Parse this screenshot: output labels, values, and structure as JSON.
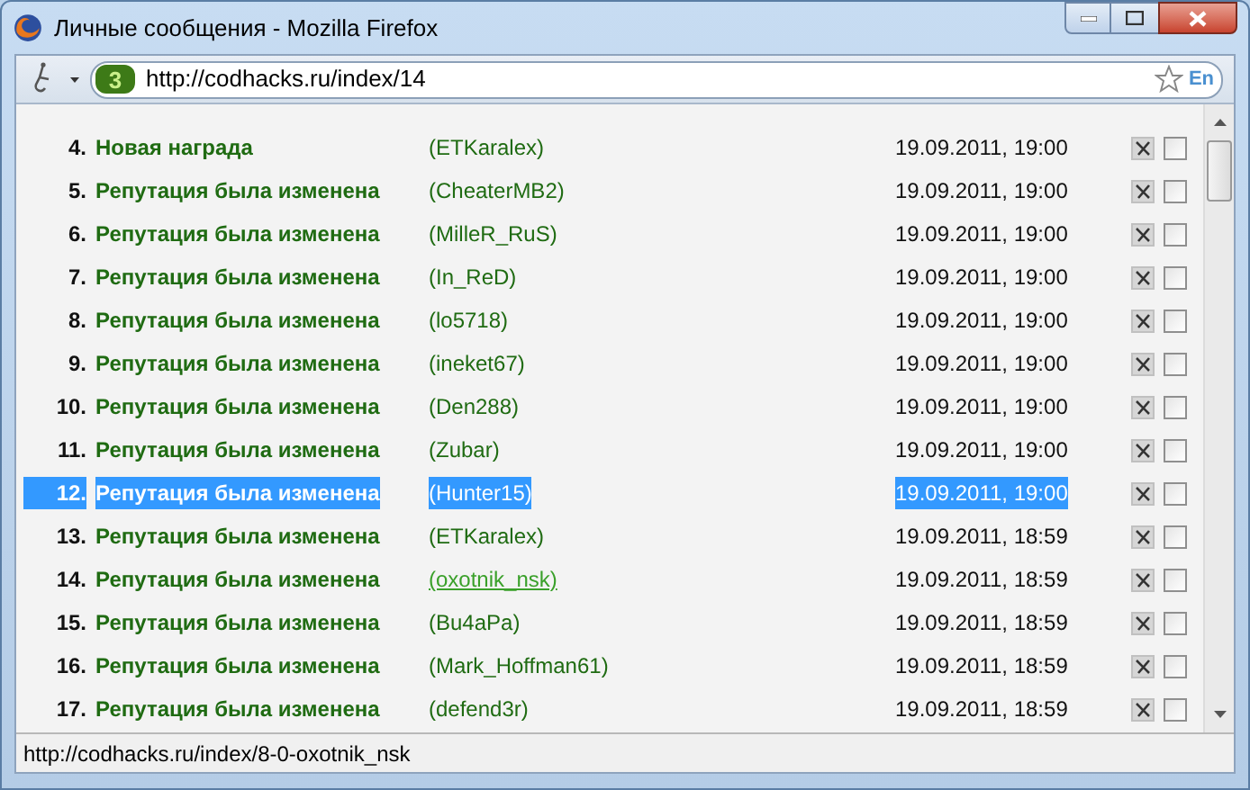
{
  "window": {
    "title": "Личные сообщения - Mozilla Firefox"
  },
  "address_bar": {
    "site_badge": "3",
    "url": "http://codhacks.ru/index/14",
    "lang": "En"
  },
  "messages": [
    {
      "number": "4.",
      "title": "Новая награда",
      "user": "(ETKaralex)",
      "date": "19.09.2011, 19:00",
      "selected": false,
      "hovered": false,
      "checked": false
    },
    {
      "number": "5.",
      "title": "Репутация была изменена",
      "user": "(CheaterMB2)",
      "date": "19.09.2011, 19:00",
      "selected": false,
      "hovered": false,
      "checked": false
    },
    {
      "number": "6.",
      "title": "Репутация была изменена",
      "user": "(MilleR_RuS)",
      "date": "19.09.2011, 19:00",
      "selected": false,
      "hovered": false,
      "checked": false
    },
    {
      "number": "7.",
      "title": "Репутация была изменена",
      "user": "(In_ReD)",
      "date": "19.09.2011, 19:00",
      "selected": false,
      "hovered": false,
      "checked": false
    },
    {
      "number": "8.",
      "title": "Репутация была изменена",
      "user": "(lo5718)",
      "date": "19.09.2011, 19:00",
      "selected": false,
      "hovered": false,
      "checked": false
    },
    {
      "number": "9.",
      "title": "Репутация была изменена",
      "user": "(ineket67)",
      "date": "19.09.2011, 19:00",
      "selected": false,
      "hovered": false,
      "checked": false
    },
    {
      "number": "10.",
      "title": "Репутация была изменена",
      "user": "(Den288)",
      "date": "19.09.2011, 19:00",
      "selected": false,
      "hovered": false,
      "checked": false
    },
    {
      "number": "11.",
      "title": "Репутация была изменена",
      "user": "(Zubar)",
      "date": "19.09.2011, 19:00",
      "selected": false,
      "hovered": false,
      "checked": false
    },
    {
      "number": "12.",
      "title": "Репутация была изменена",
      "user": "(Hunter15)",
      "date": "19.09.2011, 19:00",
      "selected": true,
      "hovered": false,
      "checked": false
    },
    {
      "number": "13.",
      "title": "Репутация была изменена",
      "user": "(ETKaralex)",
      "date": "19.09.2011, 18:59",
      "selected": false,
      "hovered": false,
      "checked": false
    },
    {
      "number": "14.",
      "title": "Репутация была изменена",
      "user": "(oxotnik_nsk)",
      "date": "19.09.2011, 18:59",
      "selected": false,
      "hovered": true,
      "checked": false
    },
    {
      "number": "15.",
      "title": "Репутация была изменена",
      "user": "(Bu4aPa)",
      "date": "19.09.2011, 18:59",
      "selected": false,
      "hovered": false,
      "checked": false
    },
    {
      "number": "16.",
      "title": "Репутация была изменена",
      "user": "(Mark_Hoffman61)",
      "date": "19.09.2011, 18:59",
      "selected": false,
      "hovered": false,
      "checked": false
    },
    {
      "number": "17.",
      "title": "Репутация была изменена",
      "user": "(defend3r)",
      "date": "19.09.2011, 18:59",
      "selected": false,
      "hovered": false,
      "checked": false
    }
  ],
  "status_bar": {
    "text": "http://codhacks.ru/index/8-0-oxotnik_nsk"
  }
}
